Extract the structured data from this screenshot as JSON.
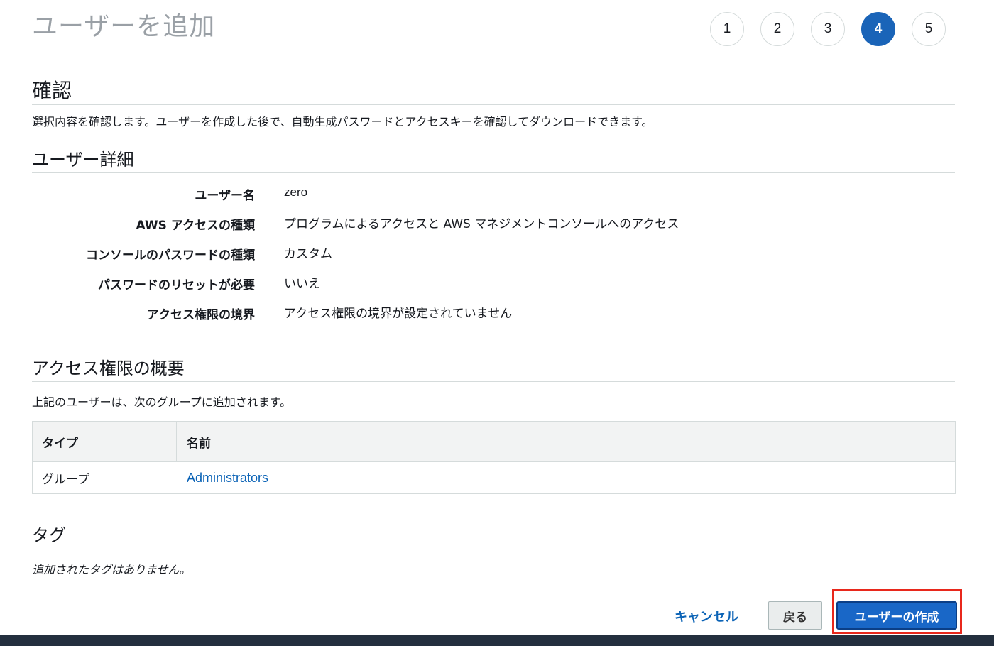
{
  "page": {
    "title": "ユーザーを追加"
  },
  "steps": [
    {
      "label": "1",
      "active": false
    },
    {
      "label": "2",
      "active": false
    },
    {
      "label": "3",
      "active": false
    },
    {
      "label": "4",
      "active": true
    },
    {
      "label": "5",
      "active": false
    }
  ],
  "review": {
    "title": "確認",
    "description": "選択内容を確認します。ユーザーを作成した後で、自動生成パスワードとアクセスキーを確認してダウンロードできます。"
  },
  "user_details": {
    "title": "ユーザー詳細",
    "rows": [
      {
        "label": "ユーザー名",
        "value": "zero"
      },
      {
        "label": "AWS アクセスの種類",
        "value": "プログラムによるアクセスと AWS マネジメントコンソールへのアクセス"
      },
      {
        "label": "コンソールのパスワードの種類",
        "value": "カスタム"
      },
      {
        "label": "パスワードのリセットが必要",
        "value": "いいえ"
      },
      {
        "label": "アクセス権限の境界",
        "value": "アクセス権限の境界が設定されていません"
      }
    ]
  },
  "permissions": {
    "title": "アクセス権限の概要",
    "description": "上記のユーザーは、次のグループに追加されます。",
    "table": {
      "headers": [
        "タイプ",
        "名前"
      ],
      "rows": [
        {
          "type": "グループ",
          "name": "Administrators"
        }
      ]
    }
  },
  "tags": {
    "title": "タグ",
    "empty_text": "追加されたタグはありません。"
  },
  "footer": {
    "cancel_label": "キャンセル",
    "back_label": "戻る",
    "create_label": "ユーザーの作成"
  },
  "colors": {
    "accent": "#1a64b8",
    "link": "#0b63b6",
    "highlight": "#e8281c",
    "bottom_bar": "#232f3e"
  }
}
